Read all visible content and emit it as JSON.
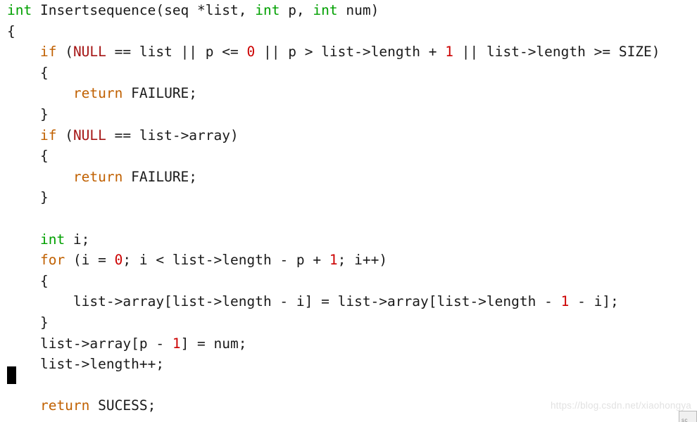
{
  "editor": {
    "background_color": "#ffffff",
    "default_text_color": "#1a1a1a",
    "language": "c",
    "syntax_colors": {
      "type_keyword": "#00a000",
      "control_keyword": "#c06000",
      "constant": "#a51515",
      "number": "#cc0000",
      "plain": "#1a1a1a"
    },
    "cursor": {
      "name": "text-cursor-block",
      "color": "#000000",
      "line_index": 18,
      "column": 0
    },
    "lines": [
      {
        "index": 0,
        "indent": 0,
        "tokens": [
          {
            "text": "int",
            "type": "type_keyword"
          },
          {
            "text": " Insertsequence(seq *list, ",
            "type": "plain"
          },
          {
            "text": "int",
            "type": "type_keyword"
          },
          {
            "text": " p, ",
            "type": "plain"
          },
          {
            "text": "int",
            "type": "type_keyword"
          },
          {
            "text": " num)",
            "type": "plain"
          }
        ]
      },
      {
        "index": 1,
        "indent": 0,
        "tokens": [
          {
            "text": "{",
            "type": "plain"
          }
        ]
      },
      {
        "index": 2,
        "indent": 1,
        "tokens": [
          {
            "text": "if",
            "type": "control_keyword"
          },
          {
            "text": " (",
            "type": "plain"
          },
          {
            "text": "NULL",
            "type": "constant"
          },
          {
            "text": " == list || p <= ",
            "type": "plain"
          },
          {
            "text": "0",
            "type": "number"
          },
          {
            "text": " || p > list->length + ",
            "type": "plain"
          },
          {
            "text": "1",
            "type": "number"
          },
          {
            "text": " || list->length >= SIZE)",
            "type": "plain"
          }
        ]
      },
      {
        "index": 3,
        "indent": 1,
        "tokens": [
          {
            "text": "{",
            "type": "plain"
          }
        ]
      },
      {
        "index": 4,
        "indent": 2,
        "tokens": [
          {
            "text": "return",
            "type": "control_keyword"
          },
          {
            "text": " FAILURE;",
            "type": "plain"
          }
        ]
      },
      {
        "index": 5,
        "indent": 1,
        "tokens": [
          {
            "text": "}",
            "type": "plain"
          }
        ]
      },
      {
        "index": 6,
        "indent": 1,
        "tokens": [
          {
            "text": "if",
            "type": "control_keyword"
          },
          {
            "text": " (",
            "type": "plain"
          },
          {
            "text": "NULL",
            "type": "constant"
          },
          {
            "text": " == list->array)",
            "type": "plain"
          }
        ]
      },
      {
        "index": 7,
        "indent": 1,
        "tokens": [
          {
            "text": "{",
            "type": "plain"
          }
        ]
      },
      {
        "index": 8,
        "indent": 2,
        "tokens": [
          {
            "text": "return",
            "type": "control_keyword"
          },
          {
            "text": " FAILURE;",
            "type": "plain"
          }
        ]
      },
      {
        "index": 9,
        "indent": 1,
        "tokens": [
          {
            "text": "}",
            "type": "plain"
          }
        ]
      },
      {
        "index": 10,
        "indent": 0,
        "tokens": [
          {
            "text": "",
            "type": "plain"
          }
        ]
      },
      {
        "index": 11,
        "indent": 1,
        "tokens": [
          {
            "text": "int",
            "type": "type_keyword"
          },
          {
            "text": " i;",
            "type": "plain"
          }
        ]
      },
      {
        "index": 12,
        "indent": 1,
        "tokens": [
          {
            "text": "for",
            "type": "control_keyword"
          },
          {
            "text": " (i = ",
            "type": "plain"
          },
          {
            "text": "0",
            "type": "number"
          },
          {
            "text": "; i < list->length - p + ",
            "type": "plain"
          },
          {
            "text": "1",
            "type": "number"
          },
          {
            "text": "; i++)",
            "type": "plain"
          }
        ]
      },
      {
        "index": 13,
        "indent": 1,
        "tokens": [
          {
            "text": "{",
            "type": "plain"
          }
        ]
      },
      {
        "index": 14,
        "indent": 2,
        "tokens": [
          {
            "text": "list->array[list->length - i] = list->array[list->length - ",
            "type": "plain"
          },
          {
            "text": "1",
            "type": "number"
          },
          {
            "text": " - i];",
            "type": "plain"
          }
        ]
      },
      {
        "index": 15,
        "indent": 1,
        "tokens": [
          {
            "text": "}",
            "type": "plain"
          }
        ]
      },
      {
        "index": 16,
        "indent": 1,
        "tokens": [
          {
            "text": "list->array[p - ",
            "type": "plain"
          },
          {
            "text": "1",
            "type": "number"
          },
          {
            "text": "] = num;",
            "type": "plain"
          }
        ]
      },
      {
        "index": 17,
        "indent": 1,
        "tokens": [
          {
            "text": "list->length++;",
            "type": "plain"
          }
        ]
      },
      {
        "index": 18,
        "indent": 0,
        "tokens": [
          {
            "text": "",
            "type": "plain"
          }
        ]
      },
      {
        "index": 19,
        "indent": 1,
        "tokens": [
          {
            "text": "return",
            "type": "control_keyword"
          },
          {
            "text": " SUCESS;",
            "type": "plain"
          }
        ]
      }
    ]
  },
  "watermark": {
    "text": "https://blog.csdn.net/xiaohongya",
    "color": "#e2e2e2"
  },
  "corner_widget": {
    "name": "scroll-corner-widget",
    "glyph_text": "sc"
  }
}
